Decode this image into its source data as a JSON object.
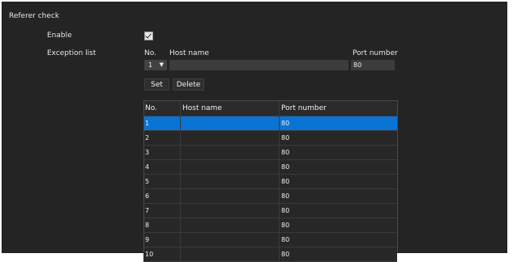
{
  "section": {
    "title": "Referer check"
  },
  "enable": {
    "label": "Enable",
    "checked": true
  },
  "exception": {
    "label": "Exception list",
    "no_label": "No.",
    "host_label": "Host name",
    "port_label": "Port number",
    "no_value": "1",
    "host_value": "",
    "port_value": "80"
  },
  "buttons": {
    "set": "Set",
    "delete": "Delete"
  },
  "table": {
    "headers": [
      "No.",
      "Host name",
      "Port number"
    ],
    "rows": [
      {
        "no": "1",
        "host": "",
        "port": "80"
      },
      {
        "no": "2",
        "host": "",
        "port": "80"
      },
      {
        "no": "3",
        "host": "",
        "port": "80"
      },
      {
        "no": "4",
        "host": "",
        "port": "80"
      },
      {
        "no": "5",
        "host": "",
        "port": "80"
      },
      {
        "no": "6",
        "host": "",
        "port": "80"
      },
      {
        "no": "7",
        "host": "",
        "port": "80"
      },
      {
        "no": "8",
        "host": "",
        "port": "80"
      },
      {
        "no": "9",
        "host": "",
        "port": "80"
      },
      {
        "no": "10",
        "host": "",
        "port": "80"
      }
    ],
    "selected_index": 0
  },
  "colors": {
    "panel": "#242424",
    "selection": "#0a74d4"
  }
}
